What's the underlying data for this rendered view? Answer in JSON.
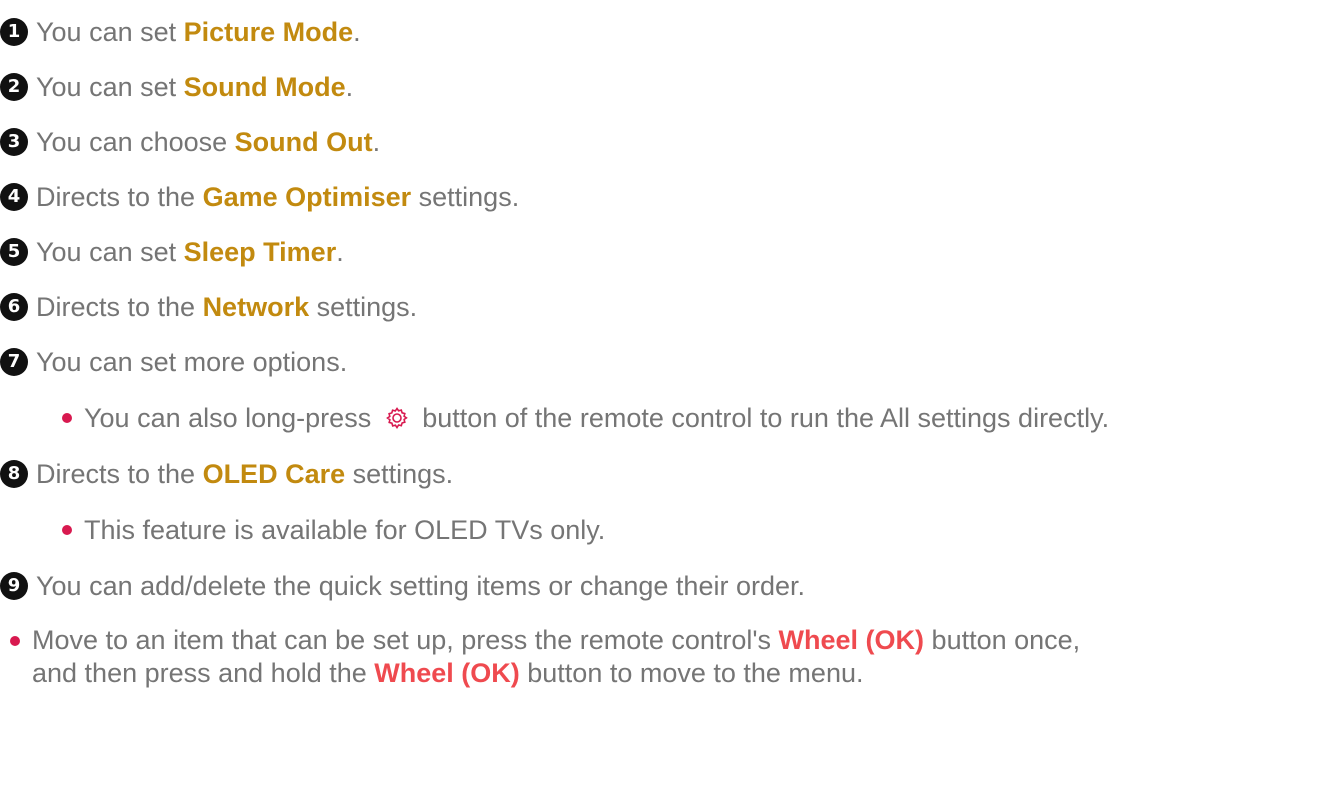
{
  "items": [
    {
      "num": "1",
      "pre": "You can set ",
      "term": "Picture Mode",
      "post": "."
    },
    {
      "num": "2",
      "pre": "You can set ",
      "term": "Sound Mode",
      "post": "."
    },
    {
      "num": "3",
      "pre": "You can choose ",
      "term": "Sound Out",
      "post": "."
    },
    {
      "num": "4",
      "pre": "Directs to the ",
      "term": "Game Optimiser",
      "post": " settings."
    },
    {
      "num": "5",
      "pre": "You can set ",
      "term": "Sleep Timer",
      "post": "."
    },
    {
      "num": "6",
      "pre": "Directs to the ",
      "term": "Network",
      "post": " settings."
    },
    {
      "num": "7",
      "text": "You can set more options."
    },
    {
      "num": "8",
      "pre": "Directs to the ",
      "term": "OLED Care",
      "post": " settings."
    },
    {
      "num": "9",
      "text": "You can add/delete the quick setting items or change their order."
    }
  ],
  "notes": {
    "item7": {
      "pre": "You can also long-press ",
      "post": " button of the remote control to run the All settings directly.",
      "icon": "gear-icon"
    },
    "item8": {
      "text": "This feature is available for OLED TVs only."
    }
  },
  "final_note": {
    "line1_pre": "Move to an item that can be set up, press the remote control's ",
    "line1_term": "Wheel (OK)",
    "line1_post": " button once,",
    "line2_pre": "and then press and hold the ",
    "line2_term": "Wheel (OK)",
    "line2_post": " button to move to the menu."
  },
  "colors": {
    "text": "#757575",
    "highlight": "#c28a0f",
    "emphasis_red": "#ef4a4f",
    "bullet": "#d8194f",
    "number_badge": "#111111"
  }
}
